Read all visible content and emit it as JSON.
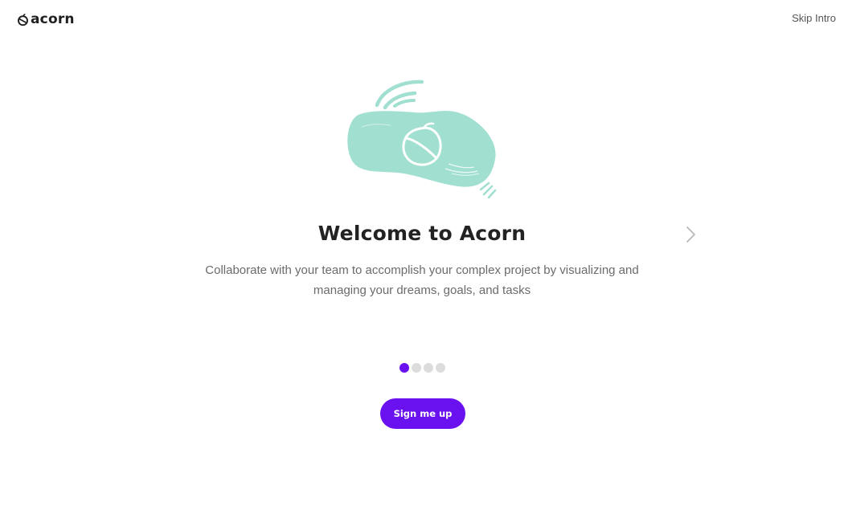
{
  "header": {
    "logo_text": "acorn",
    "logo_icon": "acorn-logo-icon",
    "skip_label": "Skip Intro"
  },
  "hero": {
    "illustration_icon": "acorn-illustration",
    "title": "Welcome to Acorn",
    "subtitle": "Collaborate with your team to accomplish your complex project by visualizing and managing your dreams, goals, and tasks",
    "next_icon": "chevron-right-icon"
  },
  "pagination": {
    "total": 4,
    "active_index": 0
  },
  "cta": {
    "label": "Sign me up"
  },
  "colors": {
    "accent": "#6a11f0",
    "illustration_fill": "#a1dfd0",
    "dot_inactive": "#dcdcdc",
    "text_primary": "#222222",
    "text_secondary": "#6b6b6b"
  }
}
